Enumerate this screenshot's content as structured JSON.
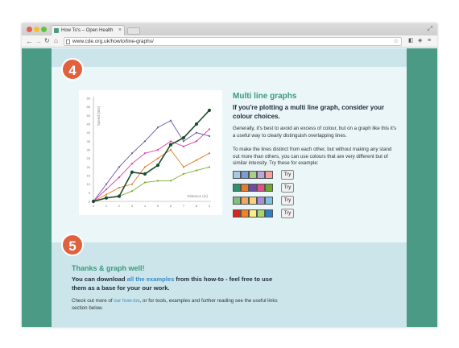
{
  "browser": {
    "tab_title": "How To's – Open Health",
    "tab_close": "×",
    "url": "www.cde.org.uk/howto/line-graphs/",
    "icons": {
      "back": "←",
      "forward": "→",
      "reload": "↻",
      "home": "⌂",
      "star": "☆",
      "ext1": "◧",
      "ext2": "◈",
      "menu": "≡",
      "fullscreen": "⤢"
    }
  },
  "sections": {
    "step4": {
      "number": "4",
      "title": "Multi line graphs",
      "subtitle": "If you're plotting a multi line graph, consider your colour choices.",
      "para1": "Generally, it's best to avoid an excess of colour, but on a graph like this it's a useful way to clearly distinguish overlapping lines.",
      "para2": "To make the lines distinct from each other, but without making any stand out more than others, you can use colours that are very different but of similar intensity. Try these for example:",
      "try_label": "Try",
      "palettes": [
        [
          "#a7c7e7",
          "#7b9bd2",
          "#a7d08c",
          "#c2a5d8",
          "#f4a29b"
        ],
        [
          "#2f8f6f",
          "#e27d2b",
          "#6b4ea2",
          "#e24f8f",
          "#6ea832"
        ],
        [
          "#7fbf7f",
          "#f2a65a",
          "#f7d27a",
          "#a88fd4",
          "#7cc2e0"
        ],
        [
          "#d7261e",
          "#f58025",
          "#f9ed85",
          "#a6d96a",
          "#2f7fc1"
        ]
      ]
    },
    "step5": {
      "number": "5",
      "title": "Thanks & graph well!",
      "bold_pre": "You can download ",
      "bold_link": "all the examples",
      "bold_post": " from this how-to - feel free to use them as a base for your our work.",
      "para_pre": "Check out more of ",
      "para_link": "our how-tos",
      "para_post": ", or for tools, examples and further reading see the useful links section below."
    }
  },
  "chart_data": {
    "type": "line",
    "title": "",
    "xlabel": "Distance (m)",
    "ylabel": "Speed (m/s)",
    "xlim": [
      0,
      9
    ],
    "ylim": [
      0,
      60
    ],
    "x": [
      0,
      1,
      2,
      3,
      4,
      5,
      6,
      7,
      8,
      9
    ],
    "y_ticks": [
      0,
      5,
      10,
      15,
      20,
      25,
      30,
      35,
      40,
      45,
      50,
      55,
      60
    ],
    "x_ticks": [
      0,
      1,
      2,
      3,
      4,
      5,
      6,
      7,
      8,
      9
    ],
    "grid": false,
    "series": [
      {
        "color": "#6a5aa8",
        "values": [
          0,
          10,
          20,
          28,
          35,
          43,
          47,
          35,
          40,
          38
        ]
      },
      {
        "color": "#d63ea8",
        "values": [
          0,
          7,
          14,
          22,
          28,
          30,
          35,
          32,
          35,
          42
        ]
      },
      {
        "color": "#e07b2a",
        "values": [
          0,
          4,
          8,
          10,
          20,
          25,
          30,
          20,
          24,
          28
        ]
      },
      {
        "color": "#7aab2e",
        "values": [
          0,
          2,
          3,
          6,
          11,
          12,
          12,
          16,
          18,
          20
        ]
      },
      {
        "color": "#1b4d2a",
        "values": [
          0,
          2,
          3,
          17,
          16,
          21,
          33,
          37,
          45,
          53
        ],
        "emphasis": true
      }
    ]
  }
}
